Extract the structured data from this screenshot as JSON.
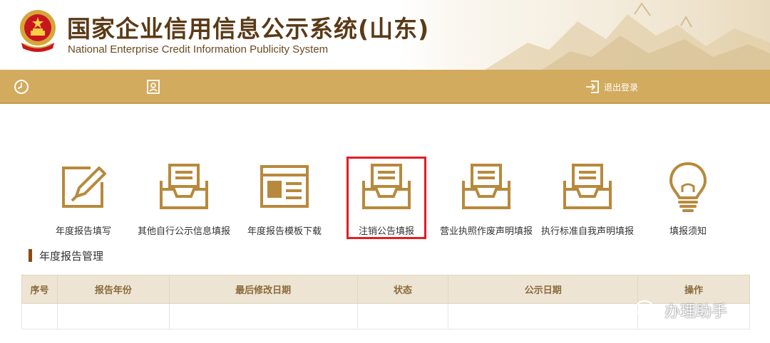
{
  "header": {
    "title_cn": "国家企业信用信息公示系统(山东)",
    "title_en": "National Enterprise Credit Information Publicity System"
  },
  "toolbar": {
    "logout_label": "退出登录"
  },
  "functions": [
    {
      "label": "年度报告填写",
      "icon": "edit-pen-icon"
    },
    {
      "label": "其他自行公示信息填报",
      "icon": "document-tray-icon"
    },
    {
      "label": "年度报告模板下载",
      "icon": "template-window-icon"
    },
    {
      "label": "注销公告填报",
      "icon": "document-tray-icon"
    },
    {
      "label": "营业执照作废声明填报",
      "icon": "document-tray-icon"
    },
    {
      "label": "执行标准自我声明填报",
      "icon": "document-tray-icon"
    },
    {
      "label": "填报须知",
      "icon": "lightbulb-icon"
    }
  ],
  "section": {
    "title": "年度报告管理"
  },
  "table": {
    "headers": [
      "序号",
      "报告年份",
      "最后修改日期",
      "状态",
      "公示日期",
      "操作"
    ]
  },
  "watermark": {
    "text": "办理助手",
    "icon": "wechat-icon"
  },
  "colors": {
    "toolbar": "#d2ab5f",
    "icon_gold": "#b8893c",
    "title_brown": "#5a3a16",
    "highlight_red": "#e51c23"
  }
}
